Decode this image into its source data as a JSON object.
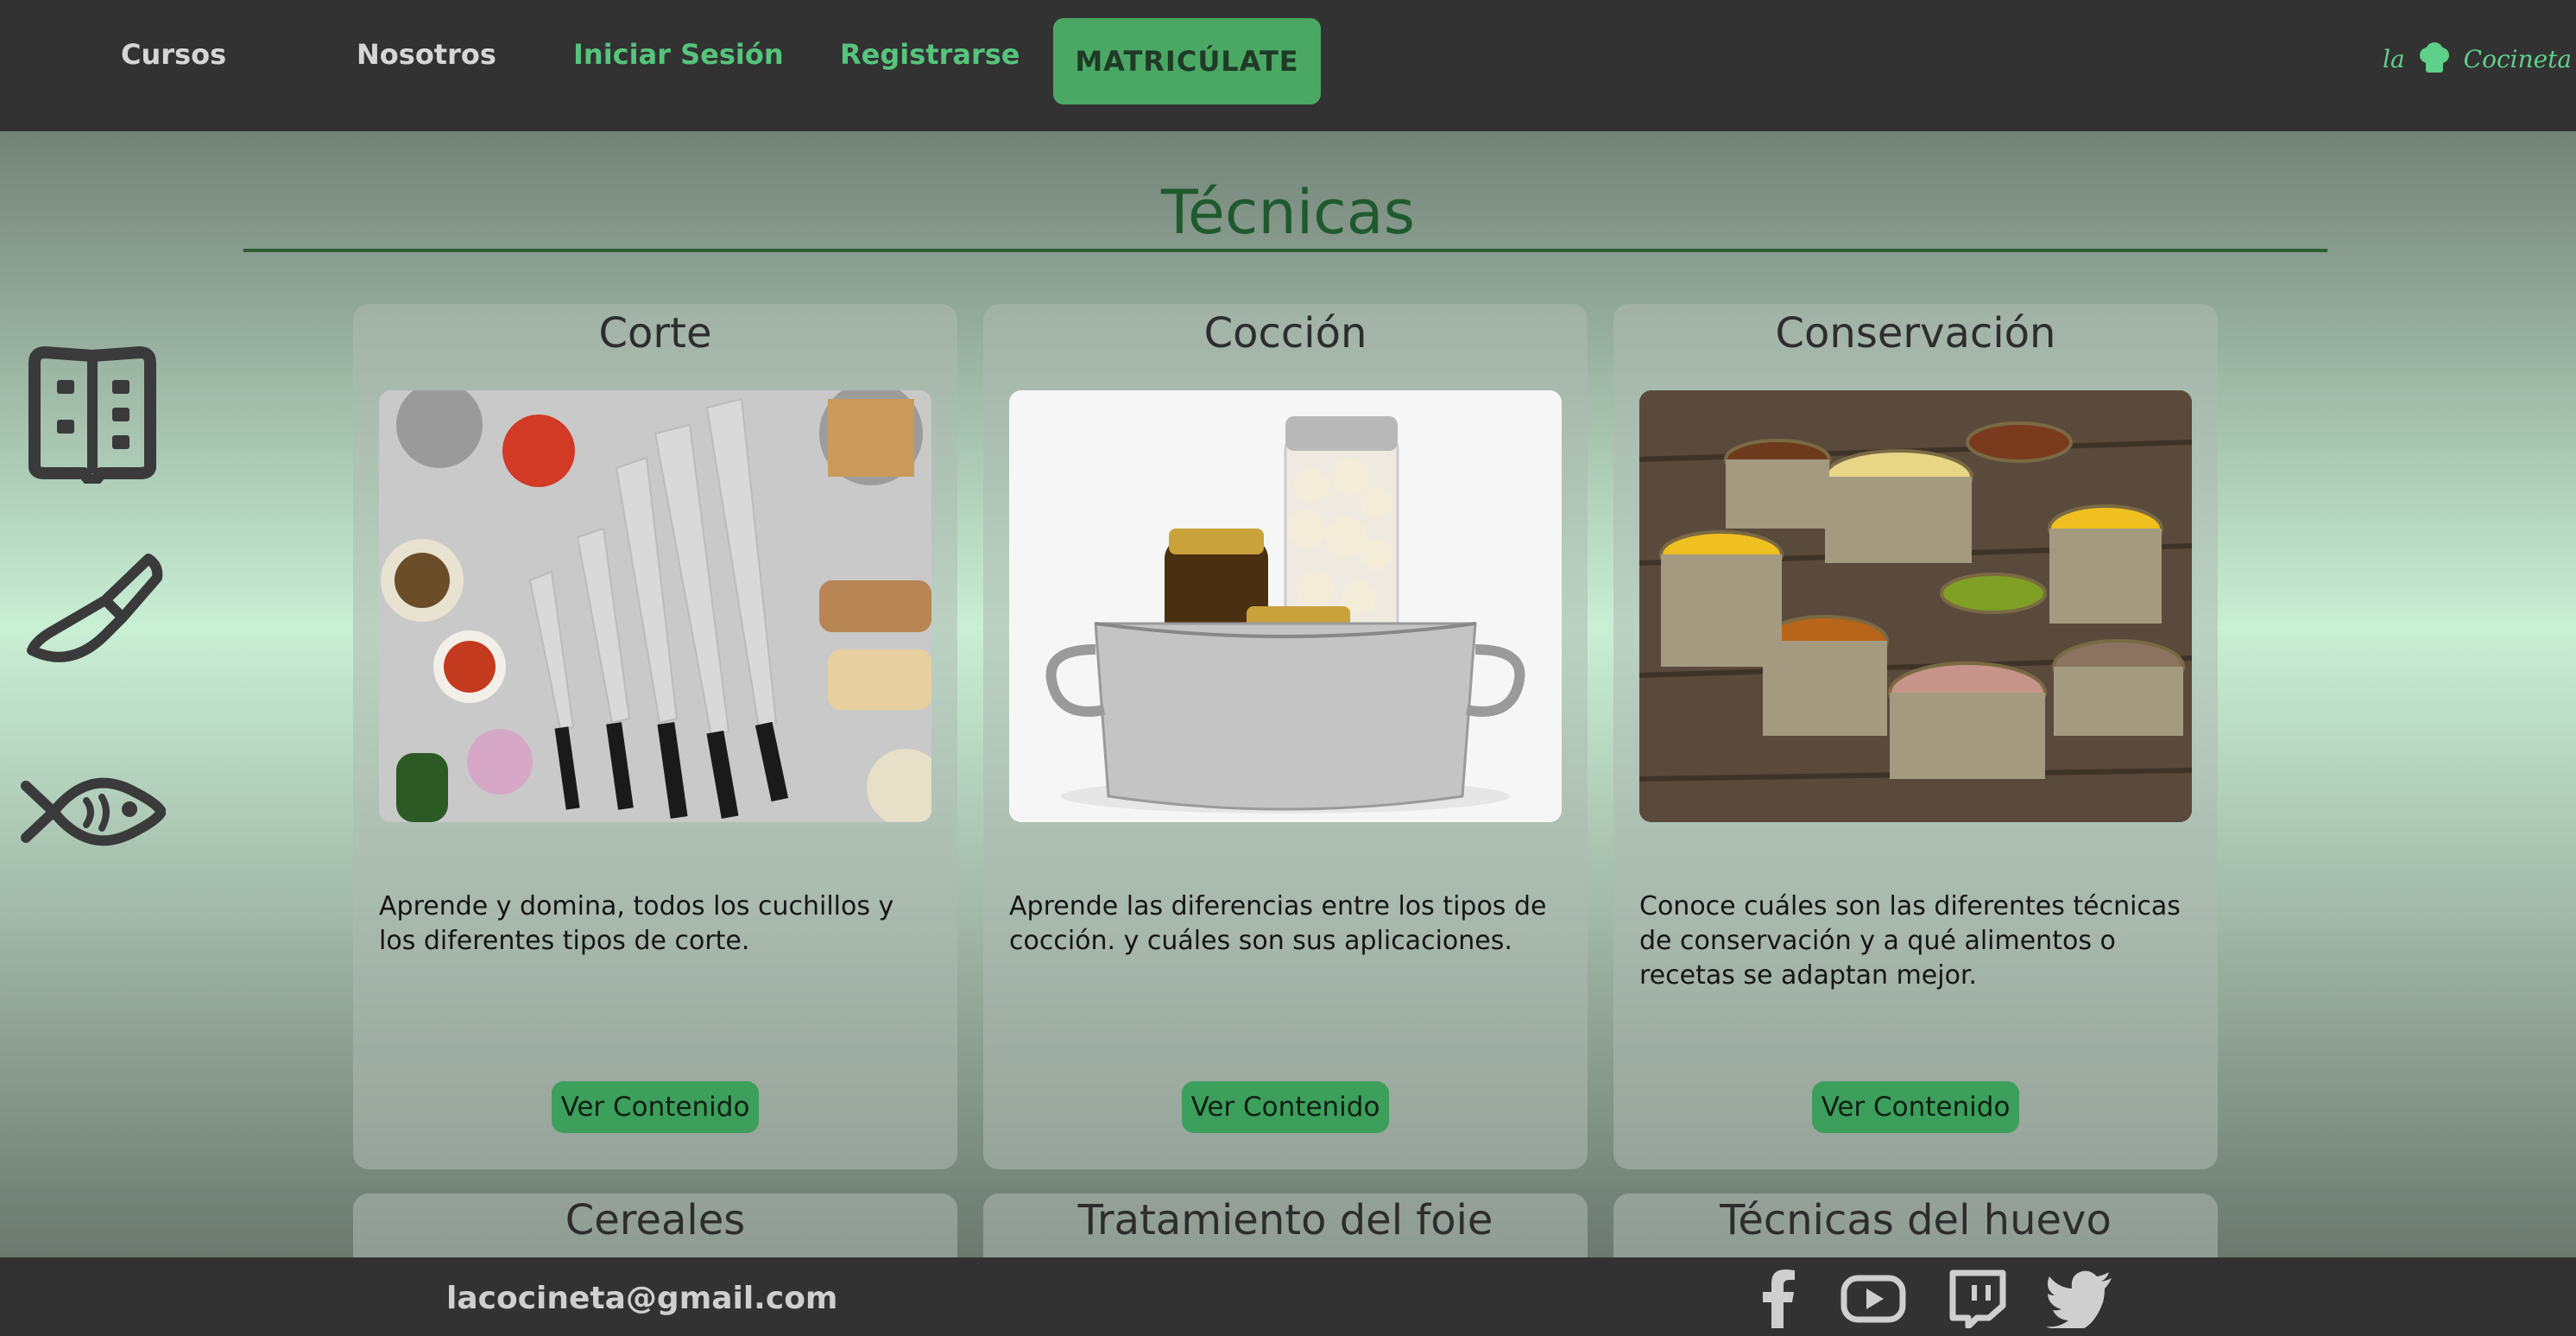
{
  "nav": {
    "links": [
      {
        "label": "Cursos",
        "color": "#d6d6d6"
      },
      {
        "label": "Nosotros",
        "color": "#d6d6d6"
      },
      {
        "label": "Iniciar Sesión",
        "color": "#56c47c"
      },
      {
        "label": "Registrarse",
        "color": "#56c47c"
      }
    ],
    "cta_label": "MATRICÚLATE",
    "logo_left": "la",
    "logo_right": "Cocineta"
  },
  "page": {
    "title": "Técnicas"
  },
  "side_icons": [
    "recipe-book-icon",
    "knife-icon",
    "fish-icon"
  ],
  "cards": [
    {
      "title": "Corte",
      "description": "Aprende y domina, todos los cuchillos y los diferentes tipos de corte.",
      "button": "Ver Contenido",
      "image": "knives-and-vegetables-photo"
    },
    {
      "title": "Cocción",
      "description": "Aprende las diferencias entre los tipos de cocción. y cuáles son sus aplicaciones.",
      "button": "Ver Contenido",
      "image": "jars-in-pot-photo"
    },
    {
      "title": "Conservación",
      "description": "Conoce cuáles son las diferentes técnicas de conservación y a qué alimentos o recetas se adaptan mejor.",
      "button": "Ver Contenido",
      "image": "canned-food-photo"
    }
  ],
  "cards_lower": [
    {
      "title": "Cereales"
    },
    {
      "title": "Tratamiento del foie"
    },
    {
      "title": "Técnicas del huevo"
    }
  ],
  "footer": {
    "email": "lacocineta@gmail.com",
    "social": [
      "facebook-icon",
      "youtube-icon",
      "twitch-icon",
      "twitter-icon"
    ]
  },
  "colors": {
    "accent": "#4aa864",
    "nav_bg": "#323232",
    "title_green": "#1f5a2e"
  }
}
